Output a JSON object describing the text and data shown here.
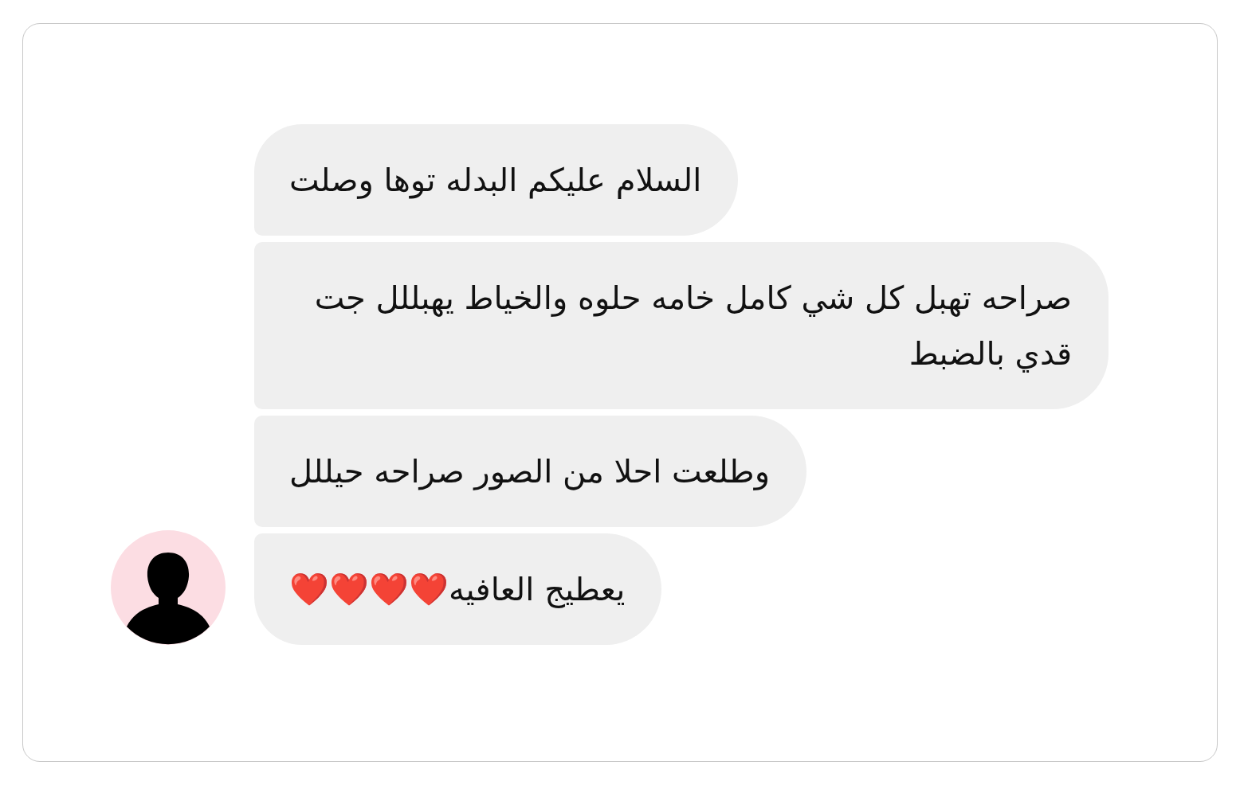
{
  "messages": [
    {
      "text": "السلام عليكم البدله توها وصلت"
    },
    {
      "text": "صراحه تهبل كل شي كامل خامه حلوه والخياط يهبللل جت قدي بالضبط"
    },
    {
      "text": "وطلعت احلا من الصور صراحه حيللل"
    },
    {
      "text": "يعطيج العافيه❤️❤️❤️❤️"
    }
  ]
}
